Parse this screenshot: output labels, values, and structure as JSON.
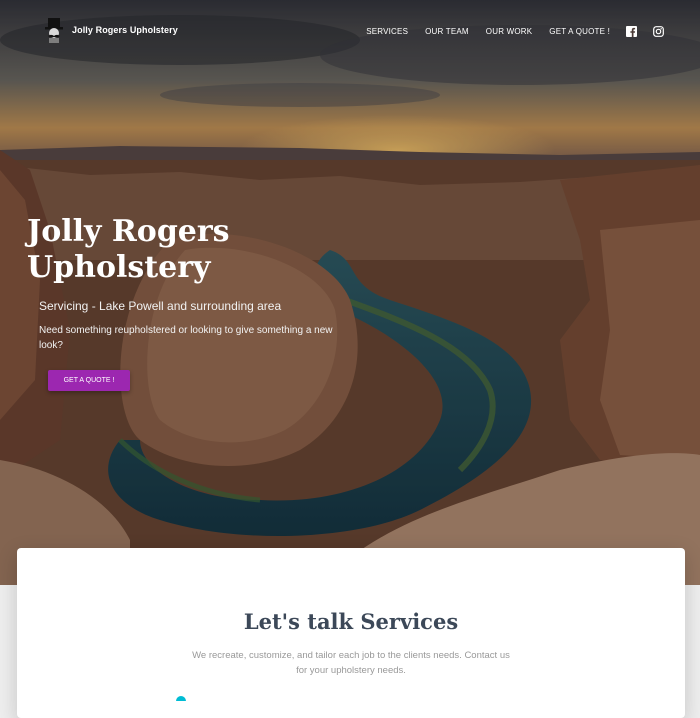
{
  "brand": {
    "name": "Jolly Rogers Upholstery",
    "logo_icon": "top-hat-mustache-icon"
  },
  "nav": {
    "links": [
      "SERVICES",
      "OUR TEAM",
      "OUR WORK",
      "GET A QUOTE !"
    ],
    "social": [
      {
        "icon": "facebook-icon"
      },
      {
        "icon": "instagram-icon"
      }
    ]
  },
  "hero": {
    "title": "Jolly Rogers Upholstery",
    "subtitle": "Servicing - Lake Powell and surrounding area",
    "text": "Need something reupholstered or looking to give something a new look?",
    "cta_label": "GET A QUOTE !",
    "background": "canyon-river-landscape"
  },
  "services": {
    "title": "Let's talk Services",
    "description": "We recreate, customize, and tailor each job to the clients needs. Contact us for your upholstery needs."
  },
  "colors": {
    "accent": "#9c27b0",
    "heading": "#3c4858",
    "muted_text": "#999999",
    "teal": "#00bcd4"
  }
}
